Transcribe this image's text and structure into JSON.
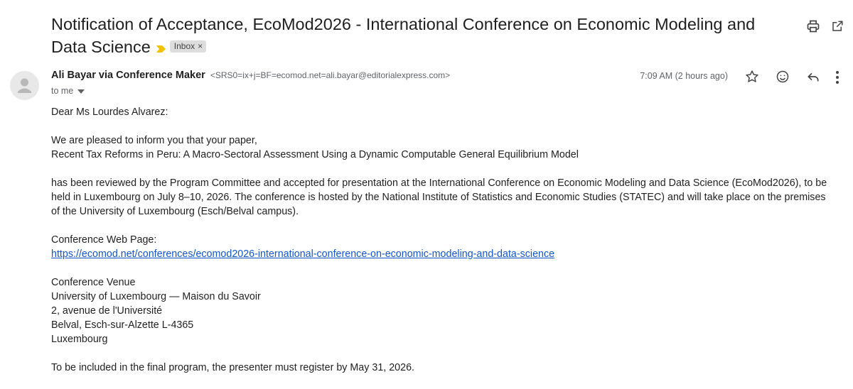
{
  "email": {
    "subject": "Notification of Acceptance, EcoMod2026 - International Conference on Economic Modeling and Data Science",
    "label": "Inbox",
    "label_remove": "×",
    "sender_name": "Ali Bayar via Conference Maker",
    "sender_email": "<SRS0=ix+j=BF=ecomod.net=ali.bayar@editorialexpress.com>",
    "to": "to me",
    "time": "7:09 AM (2 hours ago)"
  },
  "icons": {
    "top": [
      "print-icon",
      "open-in-new-window-icon"
    ],
    "actions": [
      "star-icon",
      "emoji-reaction-icon",
      "reply-icon",
      "more-vert-icon"
    ],
    "label_marker_color": "#f2c200"
  },
  "body": {
    "greeting": "Dear Ms Lourdes Alvarez:",
    "intro": "We are pleased to inform you that your paper,",
    "paper_title": "Recent Tax Reforms in Peru: A Macro-Sectoral Assessment Using a Dynamic Computable General Equilibrium Model",
    "paragraph": "has been reviewed by the Program Committee and accepted for presentation at the International Conference on Economic Modeling and Data Science (EcoMod2026), to be held in Luxembourg on July 8–10, 2026. The conference is hosted by the National Institute of Statistics and Economic Studies (STATEC) and will take place on the premises of the University of Luxembourg (Esch/Belval campus).",
    "web_label": "Conference Web Page:",
    "web_url": "https://ecomod.net/conferences/ecomod2026-international-conference-on-economic-modeling-and-data-science",
    "venue_lines": [
      "Conference Venue",
      "University of Luxembourg — Maison du Savoir",
      "2, avenue de l'Université",
      "Belval, Esch-sur-Alzette L-4365",
      "Luxembourg"
    ],
    "closing": "To be included in the final program, the presenter must register by May 31, 2026."
  }
}
